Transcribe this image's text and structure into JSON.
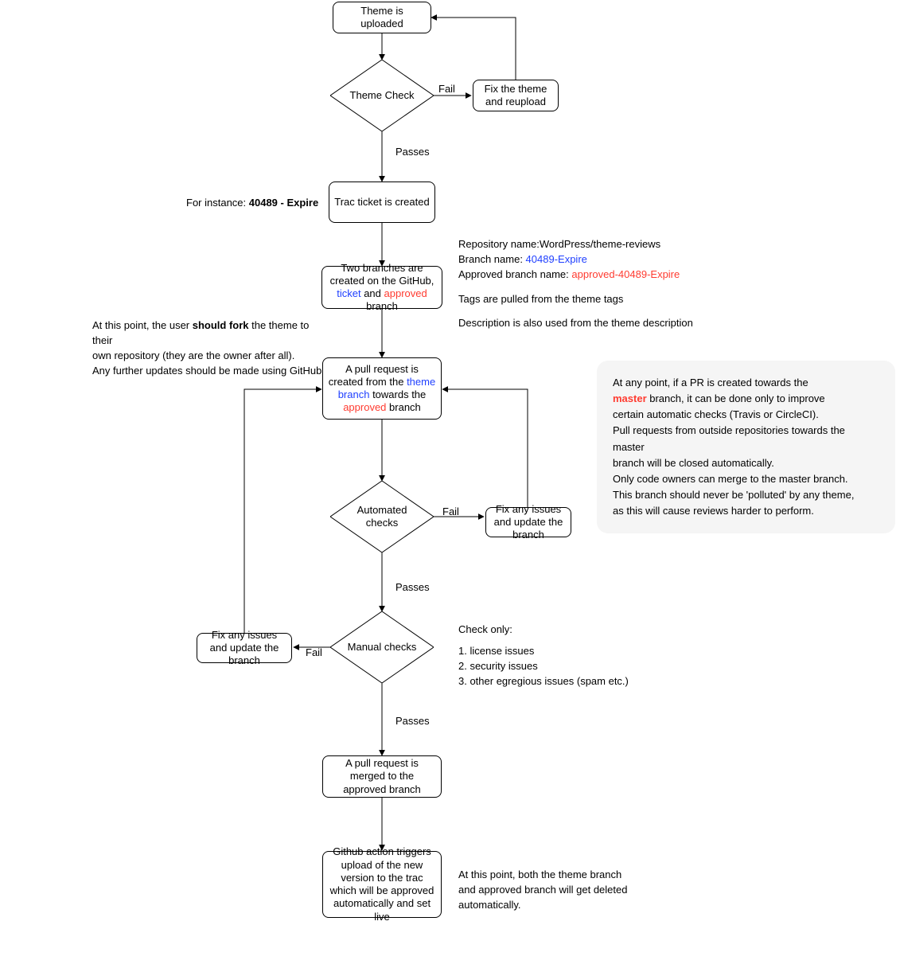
{
  "nodes": {
    "uploaded": "Theme is uploaded",
    "theme_check": "Theme Check",
    "fix_reupload": "Fix the theme and reupload",
    "trac_created": "Trac ticket is created",
    "two_branches_pre": "Two branches are created on the GitHub, ",
    "two_branches_ticket": "ticket",
    "two_branches_and": " and ",
    "two_branches_approved": "approved",
    "two_branches_post": " branch",
    "pr_pre": "A pull request is created from the ",
    "pr_theme_branch": "theme branch",
    "pr_mid": " towards the ",
    "pr_approved": "approved",
    "pr_post": " branch",
    "automated_checks": "Automated checks",
    "fix_issues_right": "Fix any issues and update the branch",
    "manual_checks": "Manual checks",
    "fix_issues_left": "Fix any issues and update the branch",
    "pr_merged": "A pull request is merged to the approved branch",
    "github_action": "Github action triggers upload of the new version to the trac which will be approved automatically and set live"
  },
  "edges": {
    "fail": "Fail",
    "passes": "Passes"
  },
  "annotations": {
    "for_instance_pre": "For instance: ",
    "for_instance_bold": "40489 - Expire",
    "repo_label": "Repository name:",
    "repo_value": "WordPress/theme-reviews",
    "branch_label": "Branch name: ",
    "branch_value": "40489-Expire",
    "approved_branch_label": "Approved branch name: ",
    "approved_branch_value": "approved-40489-Expire",
    "tags_line": "Tags are pulled from the theme tags",
    "desc_line": "Description is also used from the theme description",
    "fork_l1_pre": "At this point, the user ",
    "fork_l1_bold": "should fork",
    "fork_l1_post": " the theme to their",
    "fork_l2": "own repository (they are the owner after all).",
    "fork_l3": "Any further updates should be made using GitHub",
    "callout_l1": "At any point, if a PR is created towards the",
    "callout_master": "master",
    "callout_l1b": " branch, it can be done only to improve",
    "callout_l2": "certain automatic checks (Travis or CircleCI).",
    "callout_l3": "Pull requests from outside repositories towards the master",
    "callout_l4": "branch will be closed automatically.",
    "callout_l5": "Only code owners can merge to the master branch.",
    "callout_l6": "This branch should never be 'polluted' by any theme,",
    "callout_l7": "as this will cause reviews harder to perform.",
    "check_only_title": "Check only:",
    "check_only_1": "1. license issues",
    "check_only_2": "2. security issues",
    "check_only_3": "3. other egregious issues (spam etc.)",
    "final_l1": "At this point, both the theme branch",
    "final_l2": "and approved branch will get deleted",
    "final_l3": "automatically."
  }
}
